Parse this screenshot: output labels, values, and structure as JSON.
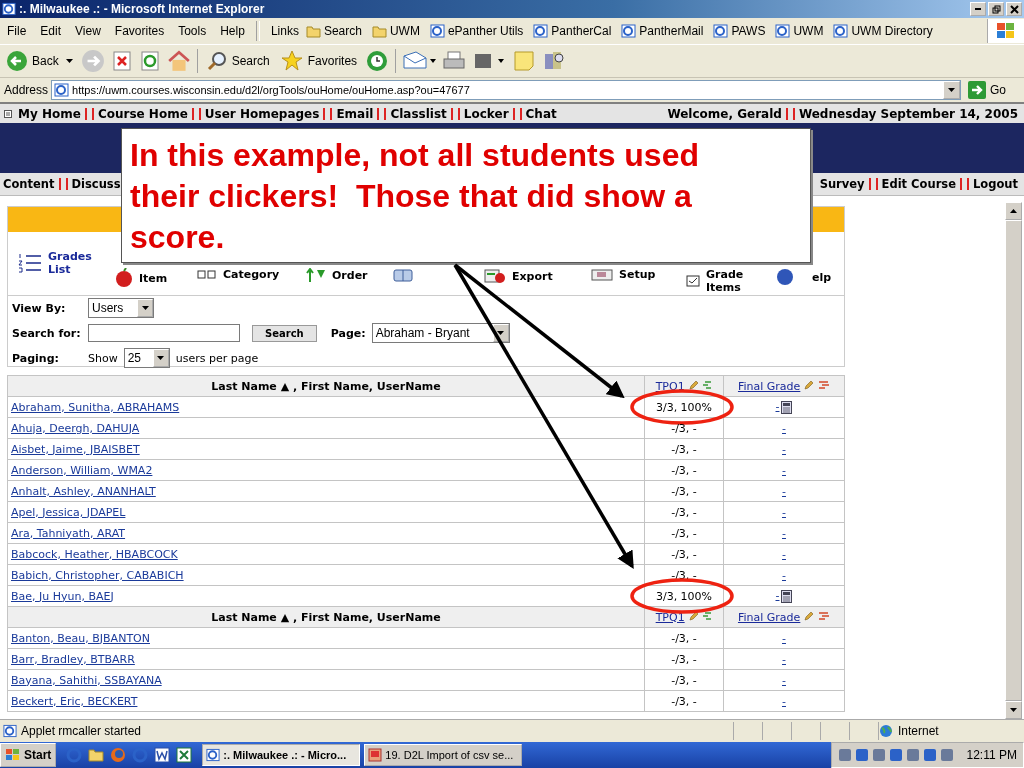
{
  "window": {
    "title": ":. Milwaukee .: - Microsoft Internet Explorer"
  },
  "menu": [
    "File",
    "Edit",
    "View",
    "Favorites",
    "Tools",
    "Help"
  ],
  "links": {
    "label": "Links",
    "items": [
      {
        "label": "Search",
        "kind": "folder"
      },
      {
        "label": "UWM",
        "kind": "folder"
      },
      {
        "label": "ePanther Utils",
        "kind": "page"
      },
      {
        "label": "PantherCal",
        "kind": "page"
      },
      {
        "label": "PantherMail",
        "kind": "page"
      },
      {
        "label": "PAWS",
        "kind": "page"
      },
      {
        "label": "UWM",
        "kind": "page"
      },
      {
        "label": "UWM Directory",
        "kind": "page"
      }
    ]
  },
  "toolbar": {
    "back": "Back",
    "search": "Search",
    "favorites": "Favorites"
  },
  "address": {
    "label": "Address",
    "url": "https://uwm.courses.wisconsin.edu/d2l/orgTools/ouHome/ouHome.asp?ou=47677",
    "go": "Go"
  },
  "site_nav": {
    "items": [
      "My Home",
      "Course Home",
      "User Homepages",
      "Email",
      "Classlist",
      "Locker",
      "Chat"
    ],
    "welcome": "Welcome, Gerald",
    "date": "Wednesday September 14, 2005"
  },
  "course_nav": {
    "left": [
      "Content",
      "Discuss"
    ],
    "right": [
      "Survey",
      "Edit Course",
      "Logout"
    ]
  },
  "tools": [
    {
      "kind": "list",
      "lines": [
        "Grades",
        "List"
      ]
    },
    {
      "kind": "apple",
      "lines": [
        "Item"
      ]
    },
    {
      "kind": "squares",
      "lines": [
        "Category"
      ]
    },
    {
      "kind": "order",
      "lines": [
        "Order"
      ]
    },
    {
      "kind": "book"
    },
    {
      "kind": "export",
      "lines": [
        "Export"
      ]
    },
    {
      "kind": "setup",
      "lines": [
        "Setup"
      ]
    },
    {
      "kind": "items",
      "lines": [
        "Grade",
        "Items"
      ]
    },
    {
      "kind": "help",
      "lines": [
        "elp"
      ]
    }
  ],
  "filters": {
    "view_by": {
      "label": "View By:",
      "value": "Users"
    },
    "search": {
      "label": "Search for:",
      "button": "Search"
    },
    "page": {
      "label": "Page:",
      "value": "Abraham - Bryant"
    },
    "paging": {
      "label": "Paging:",
      "show": "Show",
      "value": "25",
      "suffix": "users per page"
    }
  },
  "table": {
    "groups": [
      {
        "header": {
          "name": "Last Name ▲ , First Name, UserName",
          "score": "TPQ1",
          "final": "Final Grade"
        },
        "rows": [
          {
            "name": "Abraham, Sunitha, ABRAHAMS",
            "score": "3/3, 100%",
            "final": "-",
            "calculator": true,
            "circled": true
          },
          {
            "name": "Ahuja, Deergh, DAHUJA",
            "score": "-/3, -",
            "final": "-",
            "calculator": false,
            "circled": false
          },
          {
            "name": "Aisbet, Jaime, JBAISBET",
            "score": "-/3, -",
            "final": "-",
            "calculator": false,
            "circled": false
          },
          {
            "name": "Anderson, William, WMA2",
            "score": "-/3, -",
            "final": "-",
            "calculator": false,
            "circled": false
          },
          {
            "name": "Anhalt, Ashley, ANANHALT",
            "score": "-/3, -",
            "final": "-",
            "calculator": false,
            "circled": false
          },
          {
            "name": "Apel, Jessica, JDAPEL",
            "score": "-/3, -",
            "final": "-",
            "calculator": false,
            "circled": false
          },
          {
            "name": "Ara, Tahniyath, ARAT",
            "score": "-/3, -",
            "final": "-",
            "calculator": false,
            "circled": false
          },
          {
            "name": "Babcock, Heather, HBABCOCK",
            "score": "-/3, -",
            "final": "-",
            "calculator": false,
            "circled": false
          },
          {
            "name": "Babich, Christopher, CABABICH",
            "score": "-/3, -",
            "final": "-",
            "calculator": false,
            "circled": false
          },
          {
            "name": "Bae, Ju Hyun, BAEJ",
            "score": "3/3, 100%",
            "final": "-",
            "calculator": true,
            "circled": true
          }
        ]
      },
      {
        "header": {
          "name": "Last Name ▲ , First Name, UserName",
          "score": "TPQ1",
          "final": "Final Grade"
        },
        "rows": [
          {
            "name": "Banton, Beau, BJBANTON",
            "score": "-/3, -",
            "final": "-",
            "calculator": false,
            "circled": false
          },
          {
            "name": "Barr, Bradley, BTBARR",
            "score": "-/3, -",
            "final": "-",
            "calculator": false,
            "circled": false
          },
          {
            "name": "Bayana, Sahithi, SSBAYANA",
            "score": "-/3, -",
            "final": "-",
            "calculator": false,
            "circled": false
          },
          {
            "name": "Beckert, Eric, BECKERT",
            "score": "-/3, -",
            "final": "-",
            "calculator": false,
            "circled": false
          }
        ]
      }
    ]
  },
  "callout": {
    "text": "In this example, not all students used their clickers!  Those that did show a score."
  },
  "status_bar": {
    "text": "Applet rmcaller started",
    "zone": "Internet"
  },
  "taskbar": {
    "start": "Start",
    "tasks": [
      {
        "label": ":. Milwaukee .: - Micro...",
        "selected": true
      },
      {
        "label": "19. D2L Import of csv se...",
        "selected": false
      }
    ],
    "clock": "12:11 PM"
  }
}
